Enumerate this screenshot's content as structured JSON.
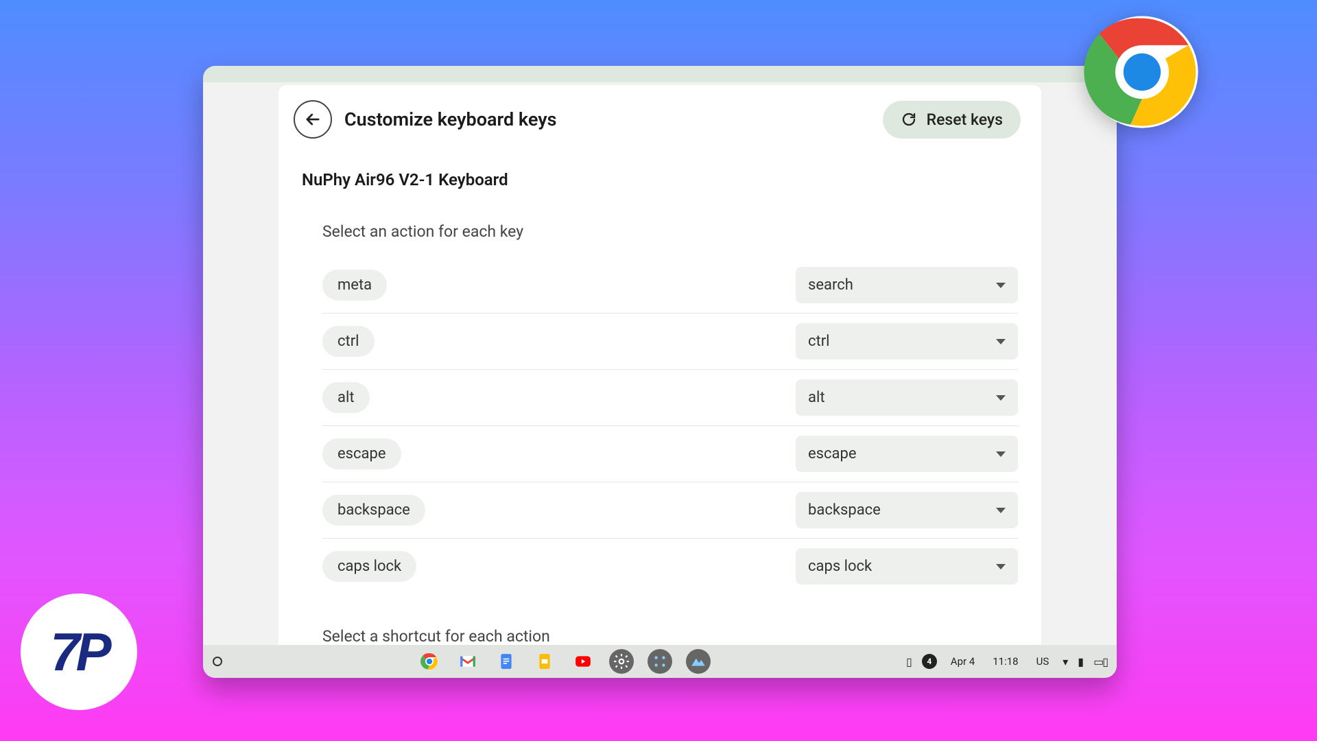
{
  "header": {
    "title": "Customize keyboard keys",
    "reset_label": "Reset keys"
  },
  "keyboard_name": "NuPhy Air96 V2-1 Keyboard",
  "section": {
    "keys_label": "Select an action for each key",
    "shortcut_label": "Select a shortcut for each action"
  },
  "key_rows": [
    {
      "key": "meta",
      "value": "search"
    },
    {
      "key": "ctrl",
      "value": "ctrl"
    },
    {
      "key": "alt",
      "value": "alt"
    },
    {
      "key": "escape",
      "value": "escape"
    },
    {
      "key": "backspace",
      "value": "backspace"
    },
    {
      "key": "caps lock",
      "value": "caps lock"
    }
  ],
  "shelf": {
    "date": "Apr 4",
    "time": "11:18",
    "ime": "US",
    "notif_count": "4"
  }
}
